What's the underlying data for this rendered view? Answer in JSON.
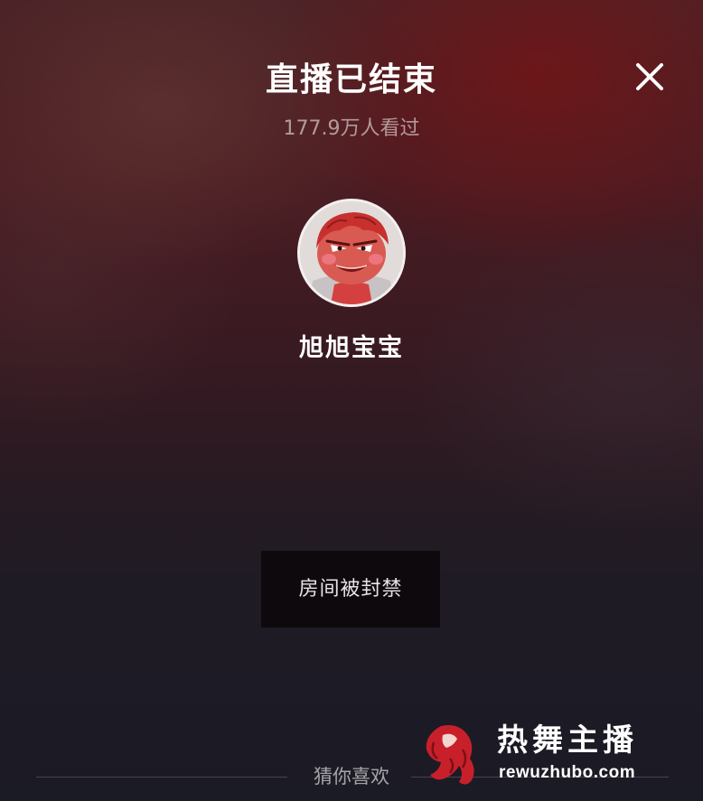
{
  "header": {
    "title": "直播已结束",
    "viewers": "177.9万人看过",
    "close_icon": "close-icon"
  },
  "streamer": {
    "name": "旭旭宝宝",
    "avatar_icon": "avatar"
  },
  "status": {
    "message": "房间被封禁"
  },
  "recommend": {
    "label": "猜你喜欢"
  },
  "watermark": {
    "title": "热舞主播",
    "url": "rewuzhubo.com"
  },
  "colors": {
    "text_primary": "#ffffff",
    "text_secondary": "#9a8e90",
    "status_bg": "#0e090c",
    "watermark_red": "#c8202a"
  }
}
